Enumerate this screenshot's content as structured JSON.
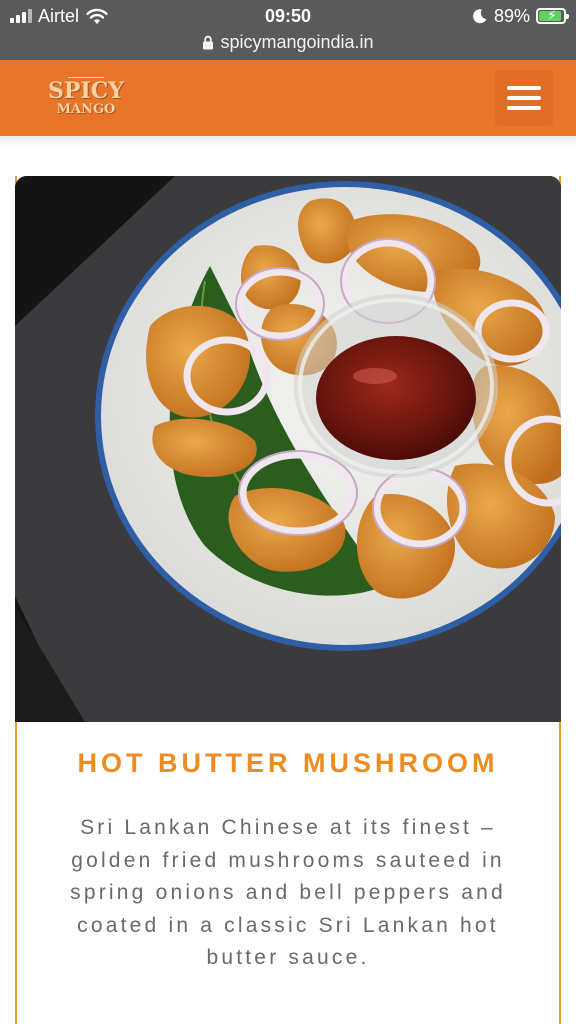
{
  "status_bar": {
    "carrier": "Airtel",
    "time": "09:50",
    "battery_percent": "89%",
    "url": "spicymangoindia.in"
  },
  "header": {
    "logo_line1": "SPICY",
    "logo_line2": "MANGO",
    "background_color": "#e8752a"
  },
  "dish": {
    "title": "HOT BUTTER MUSHROOM",
    "description": "Sri Lankan Chinese at its finest – golden fried mushrooms sauteed in spring onions and bell peppers and coated in a classic Sri Lankan hot butter sauce.",
    "title_color": "#ee8c22",
    "border_color": "#f0962b"
  }
}
